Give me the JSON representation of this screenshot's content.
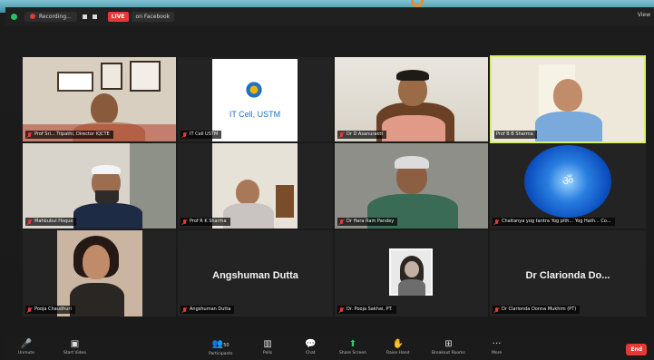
{
  "topbar": {
    "recording_label": "Recording...",
    "live_label": "LIVE",
    "live_on_label": "on Facebook",
    "view_label": "View"
  },
  "participants": [
    {
      "name": "Prof Sri... Tripathi, Director IQCTE"
    },
    {
      "name": "IT Cell USTM"
    },
    {
      "name": "Dr D Asanuraktt"
    },
    {
      "name": "Prof B B Sharma"
    },
    {
      "name": "Mahbubul Hoque"
    },
    {
      "name": "Prof R K Sharma"
    },
    {
      "name": "Dr Hara Ram Pandey"
    },
    {
      "name": "Chaitanya yog tantra Yog pith... Yog Hath... Co..."
    },
    {
      "name": "Pooja Chaudhuri"
    },
    {
      "name": "Angshuman Dutta"
    },
    {
      "name": "Dr. Pooja Sakhai, PT."
    },
    {
      "name": "Dr Clarionda Donna Mukhim (PT)"
    }
  ],
  "tiles_text": {
    "it_cell_logo_text": "IT Cell, USTM",
    "angshuman_big": "Angshuman Dutta",
    "clarionda_big": "Dr Clarionda Do..."
  },
  "toolbar": {
    "unmute": "Unmute",
    "start_video": "Start Video",
    "participants": "Participants",
    "participants_count": "50",
    "polls": "Polls",
    "chat": "Chat",
    "share_screen": "Share Screen",
    "raise_hand": "Raise Hand",
    "breakout": "Breakout Rooms",
    "more": "More",
    "end": "End"
  },
  "colors": {
    "accent_live": "#e53935",
    "active_speaker_border": "#d6f06a",
    "share_green": "#2ecc71",
    "background": "#1a1a1a"
  }
}
